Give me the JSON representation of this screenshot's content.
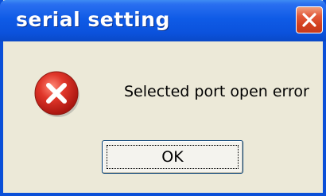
{
  "dialog": {
    "title": "serial setting",
    "message": "Selected port open error",
    "ok_label": "OK",
    "close_tooltip": ""
  },
  "icons": {
    "close": "close-icon",
    "error": "error-icon"
  },
  "colors": {
    "titlebar": "#0b52dc",
    "window_border": "#0a4fd8",
    "dialog_background": "#ece9d8",
    "close_button": "#d2401f",
    "error_icon": "#d3231b"
  }
}
